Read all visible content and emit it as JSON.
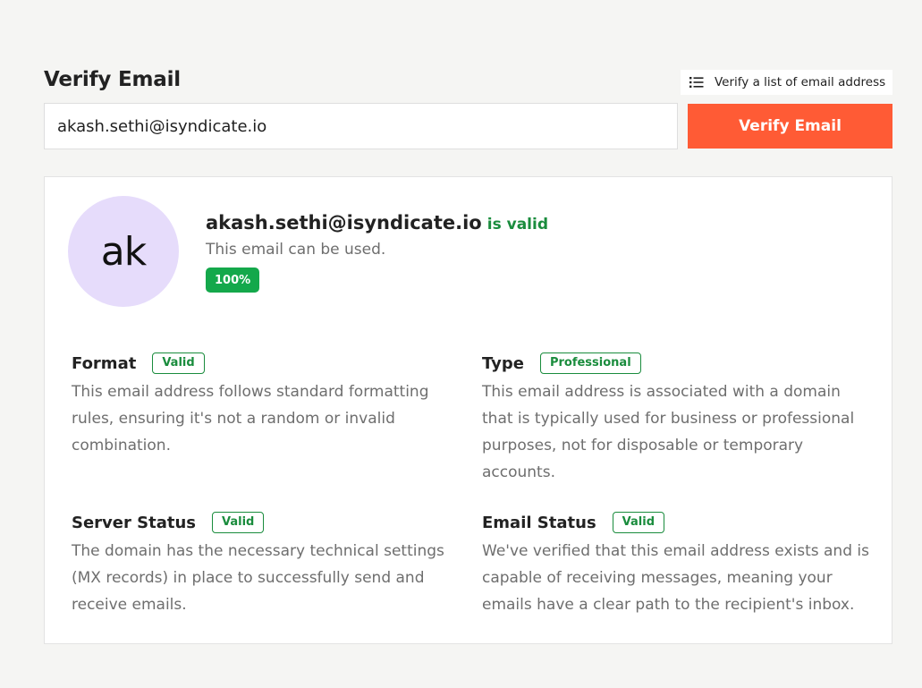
{
  "header": {
    "title": "Verify Email",
    "bulk_link_label": "Verify a list of email address"
  },
  "form": {
    "email_value": "akash.sethi@isyndicate.io",
    "verify_button_label": "Verify Email"
  },
  "result": {
    "avatar_initials": "ak",
    "email": "akash.sethi@isyndicate.io",
    "validity": "is valid",
    "description": "This email can be used.",
    "score": "100%"
  },
  "checks": [
    {
      "title": "Format",
      "badge": "Valid",
      "description": "This email address follows standard formatting rules, ensuring it's not a random or invalid combination."
    },
    {
      "title": "Type",
      "badge": "Professional",
      "description": "This email address is associated with a domain that is typically used for business or professional purposes, not for disposable or temporary accounts."
    },
    {
      "title": "Server Status",
      "badge": "Valid",
      "description": "The domain has the necessary technical settings (MX records) in place to successfully send and receive emails."
    },
    {
      "title": "Email Status",
      "badge": "Valid",
      "description": "We've verified that this email address exists and is capable of receiving messages, meaning your emails have a clear path to the recipient's inbox."
    }
  ],
  "colors": {
    "accent": "#ff5b35",
    "valid_green": "#1a8c3d",
    "score_green": "#14a84b",
    "avatar_bg": "#e6dcfb"
  },
  "icons": {
    "bulk_link": "list-icon"
  }
}
